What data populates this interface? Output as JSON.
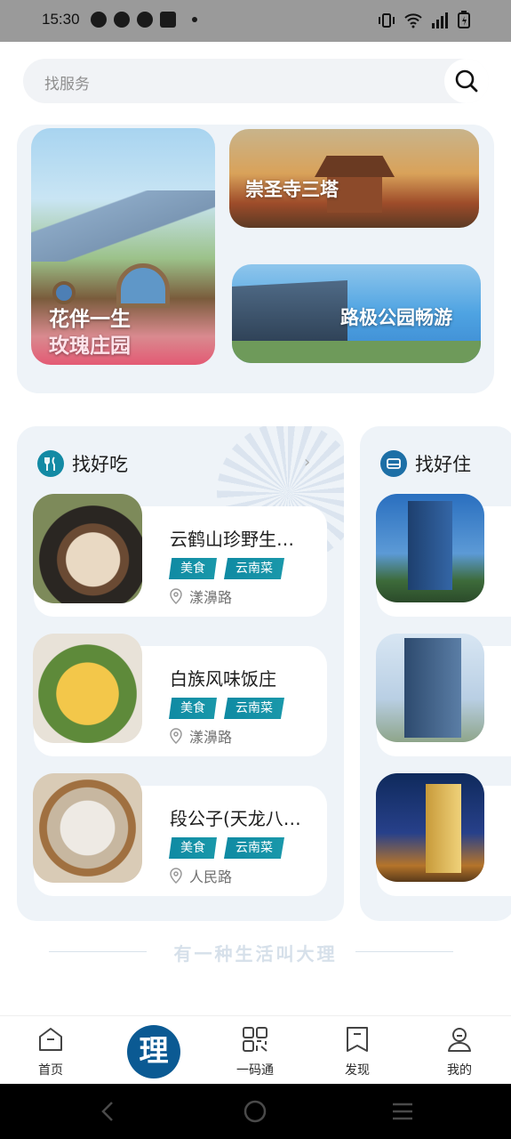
{
  "status_bar": {
    "time": "15:30"
  },
  "search": {
    "placeholder": "找服务"
  },
  "banners": [
    {
      "line1": "花伴一生",
      "line2": "玫瑰庄园"
    },
    {
      "title": "崇圣寺三塔"
    },
    {
      "title": "路极公园畅游"
    }
  ],
  "food": {
    "title": "找好吃",
    "more": "›",
    "items": [
      {
        "name": "云鹤山珍野生…",
        "tags": [
          "美食",
          "云南菜"
        ],
        "location": "漾濞路"
      },
      {
        "name": "白族风味饭庄",
        "tags": [
          "美食",
          "云南菜"
        ],
        "location": "漾濞路"
      },
      {
        "name": "段公子(天龙八…",
        "tags": [
          "美食",
          "云南菜"
        ],
        "location": "人民路"
      }
    ]
  },
  "stay": {
    "title": "找好住"
  },
  "slogan": "有一种生活叫大理",
  "tabbar": {
    "items": [
      {
        "label": "首页",
        "icon": "home-icon"
      },
      {
        "label": "一码通",
        "icon": "qr-code-icon"
      },
      {
        "label": "发现",
        "icon": "bookmark-icon"
      },
      {
        "label": "我的",
        "icon": "user-icon"
      }
    ],
    "center_label": "理"
  },
  "colors": {
    "accent": "#138aa4",
    "brand": "#0b5a93",
    "panel": "#eef3f8"
  }
}
